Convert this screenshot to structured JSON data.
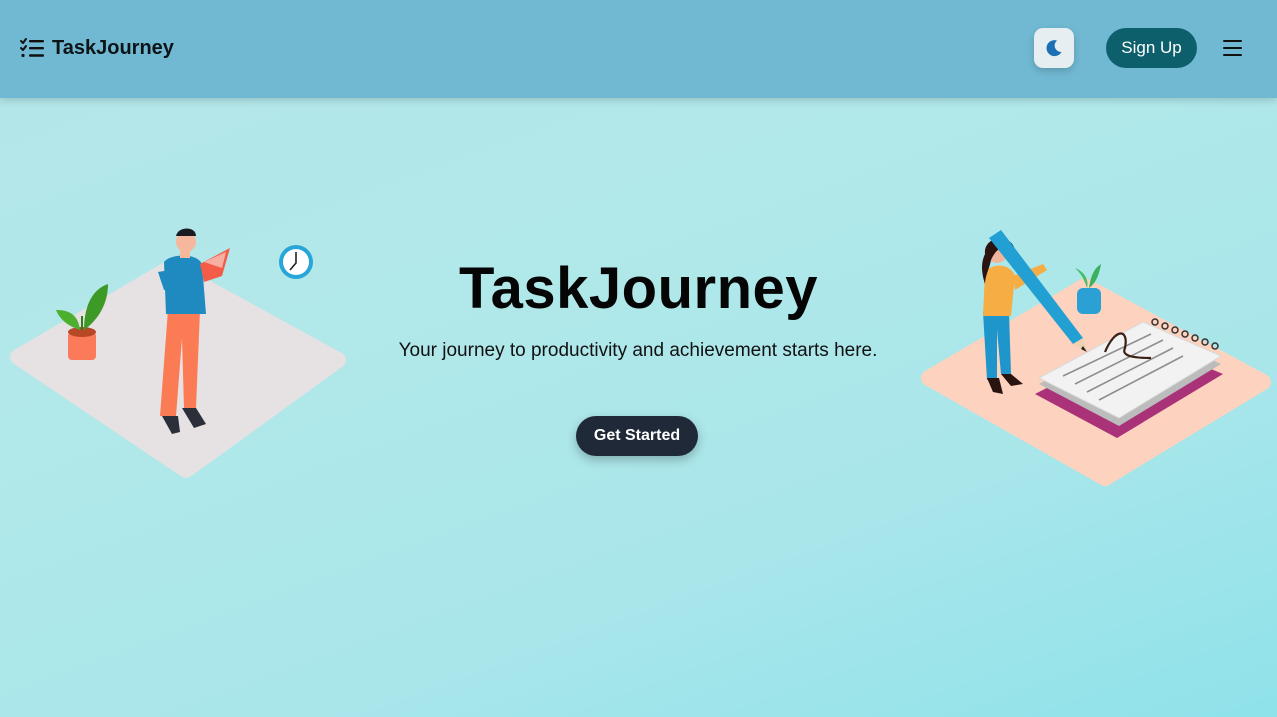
{
  "brand": {
    "name": "TaskJourney",
    "icon": "checklist-icon"
  },
  "nav": {
    "theme_icon": "moon-icon",
    "signup_label": "Sign Up",
    "menu_icon": "hamburger-icon"
  },
  "hero": {
    "title": "TaskJourney",
    "subtitle": "Your journey to productivity and achievement starts here.",
    "cta_label": "Get Started"
  },
  "colors": {
    "navbar": "#71b9d3",
    "signup_bg": "#0e5f6c",
    "cta_bg": "#1f2937",
    "moon": "#1c6fb3"
  }
}
